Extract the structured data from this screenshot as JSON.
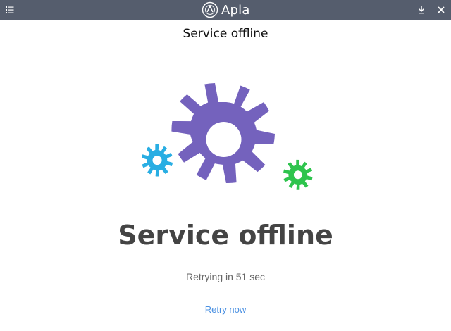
{
  "titlebar": {
    "brand": "Apla",
    "background": "#555d6d",
    "icons": {
      "menu": "list-icon",
      "download": "download-icon",
      "close": "close-icon"
    }
  },
  "page": {
    "title": "Service offline"
  },
  "illustration": {
    "colors": {
      "large_gear": "#7462bd",
      "left_gear": "#29aee3",
      "right_gear": "#2ec44d"
    }
  },
  "status": {
    "headline": "Service offline",
    "retry_text": "Retrying in 51 sec",
    "retry_action": "Retry now"
  },
  "colors": {
    "link": "#4a90e2",
    "headline": "#444444"
  }
}
